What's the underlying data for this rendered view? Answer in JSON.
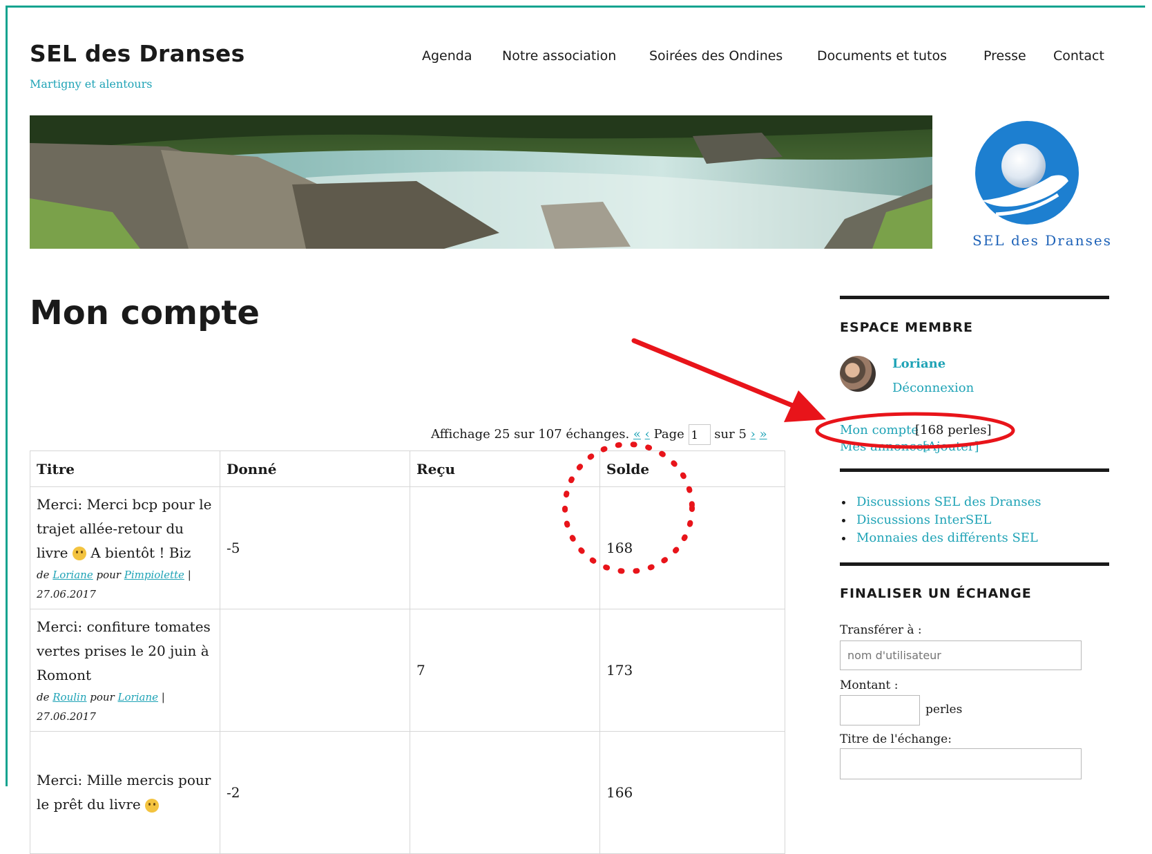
{
  "site": {
    "title": "SEL des Dranses",
    "description": "Martigny et alentours",
    "logo_text": "SEL des Dranses"
  },
  "nav": {
    "items": [
      {
        "label": "Agenda"
      },
      {
        "label": "Notre association"
      },
      {
        "label": "Soirées des Ondines"
      },
      {
        "label": "Documents et tutos"
      },
      {
        "label": "Presse"
      },
      {
        "label": "Contact"
      }
    ]
  },
  "page": {
    "title": "Mon compte"
  },
  "pager": {
    "summary": "Affichage 25 sur 107 échanges.",
    "first": "«",
    "prev": "‹",
    "page_label": "Page",
    "page_value": "1",
    "of_label": "sur 5",
    "next": "›",
    "last": "»"
  },
  "table": {
    "headers": [
      "Titre",
      "Donné",
      "Reçu",
      "Solde"
    ],
    "rows": [
      {
        "title_before_emoji": "Merci: Merci bcp pour le trajet allée-retour du livre",
        "title_after_emoji": "A bientôt ! Biz",
        "from_prefix": "de",
        "from": "Loriane",
        "to_prefix": "pour",
        "to": "Pimpiolette",
        "date": "27.06.2017",
        "given": "-5",
        "received": "",
        "balance": "168"
      },
      {
        "title_before_emoji": "Merci: confiture tomates vertes prises le 20 juin à Romont",
        "title_after_emoji": "",
        "from_prefix": "de",
        "from": "Roulin",
        "to_prefix": "pour",
        "to": "Loriane",
        "date": "27.06.2017",
        "given": "",
        "received": "7",
        "balance": "173"
      },
      {
        "title_before_emoji": "Merci: Mille mercis pour le prêt du livre",
        "title_after_emoji": "",
        "given": "-2",
        "received": "",
        "balance": "166"
      }
    ]
  },
  "sidebar": {
    "member_title": "ESPACE MEMBRE",
    "user_name": "Loriane",
    "logout": "Déconnexion",
    "account_link": "Mon compte",
    "account_balance": "[168 perles]",
    "ads_link": "Mes annonces",
    "ads_add": "[Ajouter]",
    "links": [
      "Discussions SEL des Dranses",
      "Discussions InterSEL",
      "Monnaies des différents SEL"
    ],
    "exchange_title": "FINALISER UN ÉCHANGE",
    "transfer_label": "Transférer à :",
    "transfer_placeholder": "nom d'utilisateur",
    "amount_label": "Montant :",
    "amount_unit": "perles",
    "exchange_title_label": "Titre de l'échange:"
  },
  "colors": {
    "accent": "#1fa3b6",
    "frame": "#12a38f",
    "annotation": "#e8141a",
    "logo": "#1d62b8"
  }
}
